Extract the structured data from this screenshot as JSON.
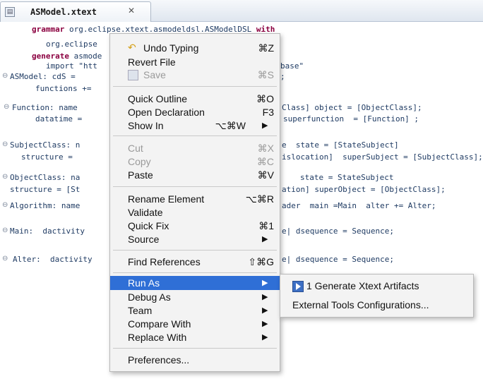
{
  "tab": {
    "title": "ASModel.xtext",
    "close": "✕"
  },
  "code": {
    "l1_kw": "grammar",
    "l1_rest": " org.eclipse.xtext.asmodeldsl.ASModelDSL ",
    "l1_with": "with",
    "l2": "org.eclipse",
    "l3_kw": "generate",
    "l3_rest": " asmode",
    "l4": "import \"htt",
    "l4_tail": "base\"",
    "l5": "ASModel: cdS =",
    "l5_tail": ";",
    "l6": "functions +=",
    "l7": "Function: name",
    "l7_tail": "Class] object = [ObjectClass];",
    "l8": "datatime =",
    "l8_tail": "superfunction  = [Function] ;",
    "l9": "SubjectClass: n",
    "l9_tail": "e  state = [StateSubject]",
    "l10": "structure =",
    "l10_tail": "islocation]  superSubject = [SubjectClass];",
    "l11": "ObjectClass: na",
    "l11_tail": "state = StateSubject",
    "l12": "structure = [St",
    "l12_tail": "ation] superObject = [ObjectClass];",
    "l13": "Algorithm: name",
    "l13_tail": "ader  main =Main  alter += Alter;",
    "l14": "Main:  dactivity",
    "l14_tail": "e| dsequence = Sequence;",
    "l15": "Alter:  dactivity",
    "l15_tail": "e| dsequence = Sequence;"
  },
  "menu": {
    "undo": "Undo Typing",
    "undo_sc": "⌘Z",
    "revert": "Revert File",
    "save": "Save",
    "save_sc": "⌘S",
    "quick_outline": "Quick Outline",
    "quick_outline_sc": "⌘O",
    "open_decl": "Open Declaration",
    "open_decl_sc": "F3",
    "show_in": "Show In",
    "show_in_sc": "⌥⌘W",
    "cut": "Cut",
    "cut_sc": "⌘X",
    "copy": "Copy",
    "copy_sc": "⌘C",
    "paste": "Paste",
    "paste_sc": "⌘V",
    "rename": "Rename Element",
    "rename_sc": "⌥⌘R",
    "validate": "Validate",
    "quick_fix": "Quick Fix",
    "quick_fix_sc": "⌘1",
    "source": "Source",
    "find_refs": "Find References",
    "find_refs_sc": "⇧⌘G",
    "run_as": "Run As",
    "debug_as": "Debug As",
    "team": "Team",
    "compare_with": "Compare With",
    "replace_with": "Replace With",
    "preferences": "Preferences...",
    "arrow": "▶"
  },
  "submenu": {
    "generate": "1 Generate Xtext Artifacts",
    "external": "External Tools Configurations..."
  },
  "colors": {
    "selection": "#2f6fd6",
    "keyword": "#8b0040",
    "code": "#1f3b63"
  },
  "icons": [
    "file-icon",
    "close-icon",
    "undo-icon",
    "save-icon",
    "generate-icon",
    "submenu-arrow-icon"
  ]
}
